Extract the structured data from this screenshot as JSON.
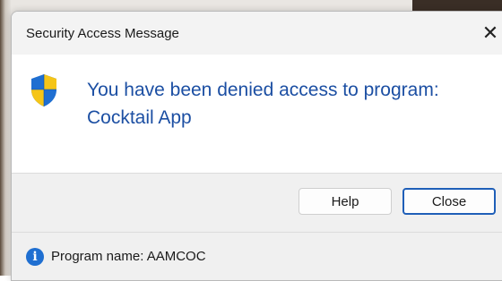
{
  "window": {
    "title": "Security Access Message",
    "close_glyph": "✕"
  },
  "message": {
    "icon": "security-shield-icon",
    "line1": "You have been denied access to program:",
    "line2": "Cocktail App",
    "color": "#1c4fa3"
  },
  "buttons": {
    "help_label": "Help",
    "close_label": "Close"
  },
  "footer": {
    "icon": "info-icon",
    "info_glyph": "i",
    "program_name": "Program name: AAMCOC"
  },
  "colors": {
    "accent": "#1f5fb8",
    "info": "#1f6fd1",
    "shield_blue": "#1f6fd1",
    "shield_yellow": "#f5c518"
  }
}
